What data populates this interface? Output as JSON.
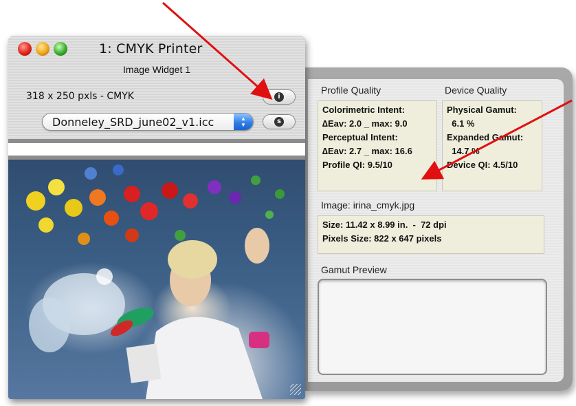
{
  "window": {
    "title": "1: CMYK Printer",
    "subtitle": "Image Widget 1",
    "dimensions": "318 x 250 pxls - CMYK",
    "info_button_icon": "info-icon",
    "info_button_glyph": "i",
    "second_button_icon": "s-icon",
    "second_button_glyph": "s",
    "profile_popup": {
      "selected": "Donneley_SRD_june02_v1.icc",
      "arrow_icon": "up-down-arrows-icon"
    },
    "traffic_lights": {
      "close_color": "#e0251b",
      "minimize_color": "#f0a418",
      "zoom_color": "#3aab2c"
    }
  },
  "drawer": {
    "profile_quality": {
      "label": "Profile Quality",
      "lines": [
        "Colorimetric Intent:",
        "∆Eav: 2.0 _ max: 9.0",
        "Perceptual Intent:",
        "∆Eav: 2.7 _ max: 16.6",
        "Profile QI: 9.5/10"
      ]
    },
    "device_quality": {
      "label": "Device Quality",
      "lines": [
        "Physical Gamut:",
        "  6.1 %",
        "Expanded Gamut:",
        "  14.7 %",
        "Device QI: 4.5/10"
      ]
    },
    "image": {
      "label": "Image: irina_cmyk.jpg",
      "lines": [
        "Size: 11.42 x 8.99 in.  -  72 dpi",
        "Pixels Size: 822 x 647 pixels"
      ]
    },
    "gamut_preview": {
      "label": "Gamut Preview"
    }
  },
  "colors": {
    "annotation_arrow": "#e01010",
    "info_background": "#efeedc"
  }
}
